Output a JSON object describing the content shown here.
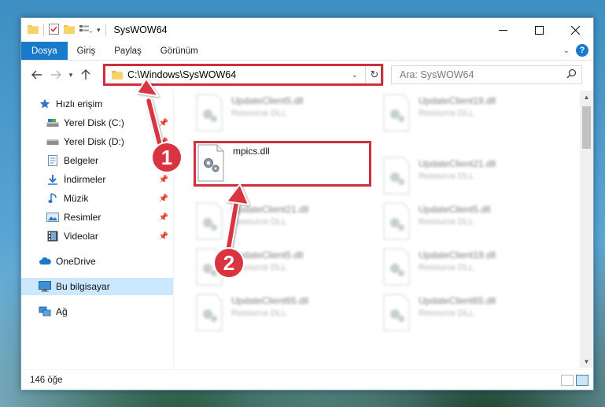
{
  "window": {
    "title": "SysWOW64"
  },
  "ribbon": {
    "tabs": [
      "Dosya",
      "Giriş",
      "Paylaş",
      "Görünüm"
    ]
  },
  "address": {
    "path": "C:\\Windows\\SysWOW64"
  },
  "search": {
    "placeholder": "Ara: SysWOW64"
  },
  "nav": {
    "items": [
      {
        "label": "Hızlı erişim",
        "icon": "star-icon",
        "pinned": false
      },
      {
        "label": "Yerel Disk (C:)",
        "icon": "drive-icon",
        "pinned": true
      },
      {
        "label": "Yerel Disk (D:)",
        "icon": "drive-icon",
        "pinned": true
      },
      {
        "label": "Belgeler",
        "icon": "documents-icon",
        "pinned": true
      },
      {
        "label": "İndirmeler",
        "icon": "download-icon",
        "pinned": true
      },
      {
        "label": "Müzik",
        "icon": "music-icon",
        "pinned": true
      },
      {
        "label": "Resimler",
        "icon": "pictures-icon",
        "pinned": true
      },
      {
        "label": "Videolar",
        "icon": "videos-icon",
        "pinned": true
      },
      {
        "label": "OneDrive",
        "icon": "cloud-icon",
        "pinned": false
      },
      {
        "label": "Bu bilgisayar",
        "icon": "computer-icon",
        "pinned": false,
        "selected": true
      },
      {
        "label": "Ağ",
        "icon": "network-icon",
        "pinned": false
      }
    ]
  },
  "files": {
    "highlighted": {
      "name": "mpics.dll"
    },
    "blurred": [
      {
        "name": "UpdateClient5.dll",
        "type": "Resource DLL"
      },
      {
        "name": "UpdateClient19.dll",
        "type": "Resource DLL"
      },
      {
        "name": "UpdateClient21.dll",
        "type": "Resource DLL"
      },
      {
        "name": "UpdateClient21.dll",
        "type": "Resource DLL"
      },
      {
        "name": "UpdateClient5.dll",
        "type": "Resource DLL"
      },
      {
        "name": "UpdateClient5.dll",
        "type": "Resource DLL"
      },
      {
        "name": "UpdateClient19.dll",
        "type": "Resource DLL"
      },
      {
        "name": "UpdateClient65.dll",
        "type": "Resource DLL"
      },
      {
        "name": "UpdateClient65.dll",
        "type": "Resource DLL"
      }
    ]
  },
  "status": {
    "count": "146 öğe"
  },
  "callouts": [
    "1",
    "2"
  ],
  "colors": {
    "accent": "#1979ca",
    "highlight": "#d0303b",
    "selected": "#cce8ff"
  }
}
